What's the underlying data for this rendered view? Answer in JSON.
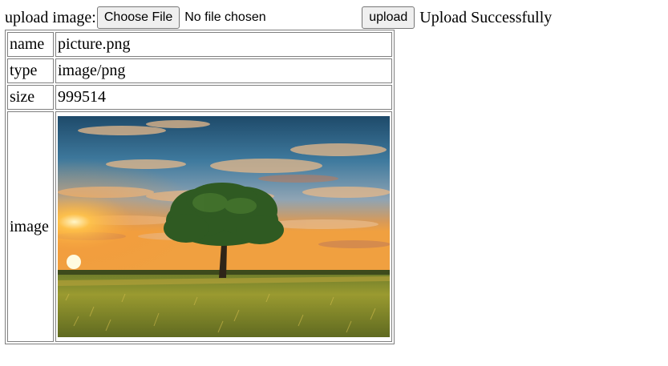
{
  "form": {
    "label": "upload image:",
    "file_button_label": "Choose File",
    "file_status": "No file chosen",
    "upload_button_label": "upload",
    "message": "Upload Successfully"
  },
  "table": {
    "rows": [
      {
        "key": "name",
        "value": "picture.png"
      },
      {
        "key": "type",
        "value": "image/png"
      },
      {
        "key": "size",
        "value": "999514"
      }
    ],
    "image_row_key": "image"
  },
  "colors": {
    "border": "#808080",
    "button_bg": "#efefef"
  },
  "icons": {
    "photo": "landscape-tree-sunset-image"
  }
}
